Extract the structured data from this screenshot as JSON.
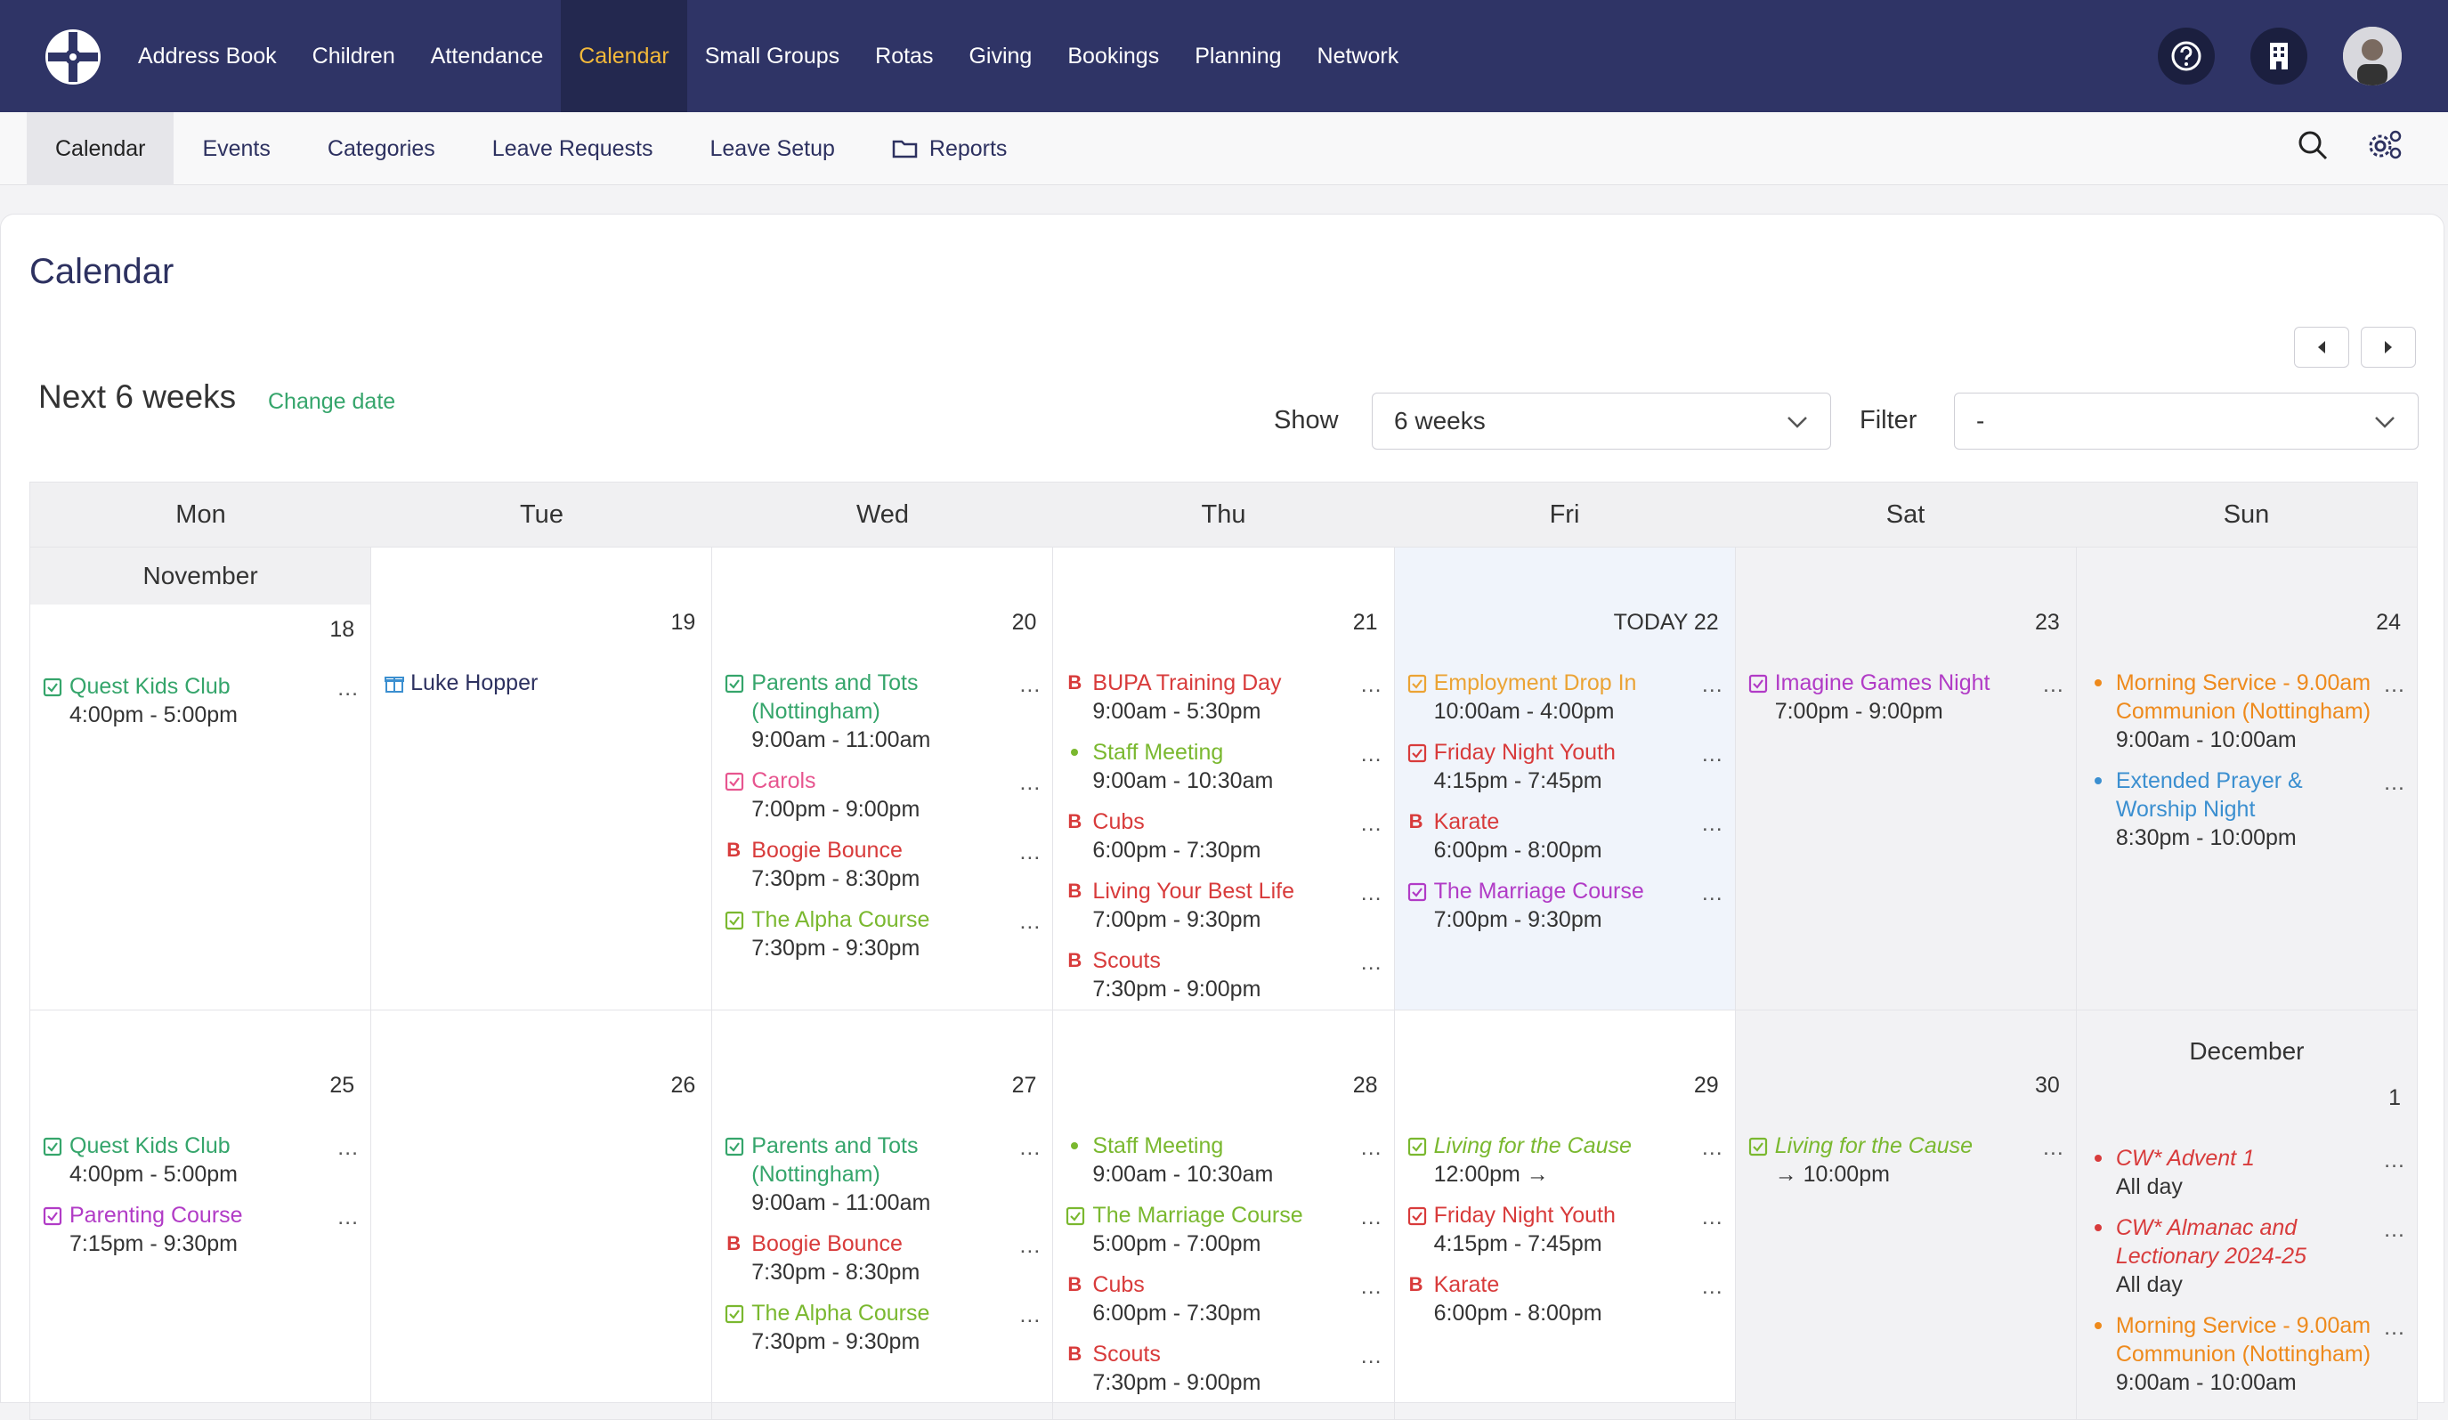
{
  "topnav": {
    "items": [
      "Address Book",
      "Children",
      "Attendance",
      "Calendar",
      "Small Groups",
      "Rotas",
      "Giving",
      "Bookings",
      "Planning",
      "Network"
    ],
    "active": "Calendar"
  },
  "subnav": {
    "items": [
      "Calendar",
      "Events",
      "Categories",
      "Leave Requests",
      "Leave Setup",
      "Reports"
    ],
    "active": "Calendar"
  },
  "page": {
    "title": "Calendar",
    "range_label": "Next 6 weeks",
    "change_date": "Change date",
    "show_label": "Show",
    "show_value": "6 weeks",
    "filter_label": "Filter",
    "filter_value": "-"
  },
  "calendar": {
    "weekdays": [
      "Mon",
      "Tue",
      "Wed",
      "Thu",
      "Fri",
      "Sat",
      "Sun"
    ],
    "months": [
      "November",
      "December"
    ],
    "today_label": "TODAY",
    "colors": {
      "green": "#35a56b",
      "lime": "#7ab82f",
      "pink": "#e7558f",
      "red": "#d83b3b",
      "orange": "#ee8a1c",
      "amber": "#eba334",
      "purple": "#b13bc6",
      "blue": "#3b8fd0",
      "navy": "#2d3160"
    },
    "weeks": [
      {
        "days": [
          {
            "num": "18",
            "events": [
              {
                "title": "Quest Kids Club",
                "time": "4:00pm - 5:00pm",
                "color": "green",
                "marker": "check"
              }
            ]
          },
          {
            "num": "19",
            "events": [
              {
                "title": "Luke Hopper",
                "time": "",
                "color": "navy",
                "marker": "gift"
              }
            ]
          },
          {
            "num": "20",
            "events": [
              {
                "title": "Parents and Tots (Nottingham)",
                "time": "9:00am - 11:00am",
                "color": "green",
                "marker": "check"
              },
              {
                "title": "Carols",
                "time": "7:00pm - 9:00pm",
                "color": "pink",
                "marker": "check"
              },
              {
                "title": "Boogie Bounce",
                "time": "7:30pm - 8:30pm",
                "color": "red",
                "marker": "B"
              },
              {
                "title": "The Alpha Course",
                "time": "7:30pm - 9:30pm",
                "color": "lime",
                "marker": "check"
              }
            ]
          },
          {
            "num": "21",
            "events": [
              {
                "title": "BUPA Training Day",
                "time": "9:00am - 5:30pm",
                "color": "red",
                "marker": "B"
              },
              {
                "title": "Staff Meeting",
                "time": "9:00am - 10:30am",
                "color": "lime",
                "marker": "dot"
              },
              {
                "title": "Cubs",
                "time": "6:00pm - 7:30pm",
                "color": "red",
                "marker": "B"
              },
              {
                "title": "Living Your Best Life",
                "time": "7:00pm - 9:30pm",
                "color": "red",
                "marker": "B"
              },
              {
                "title": "Scouts",
                "time": "7:30pm - 9:00pm",
                "color": "red",
                "marker": "B"
              }
            ]
          },
          {
            "num": "22",
            "today": true,
            "events": [
              {
                "title": "Employment Drop In",
                "time": "10:00am - 4:00pm",
                "color": "amber",
                "marker": "check"
              },
              {
                "title": "Friday Night Youth",
                "time": "4:15pm - 7:45pm",
                "color": "red",
                "marker": "check"
              },
              {
                "title": "Karate",
                "time": "6:00pm - 8:00pm",
                "color": "red",
                "marker": "B"
              },
              {
                "title": "The Marriage Course",
                "time": "7:00pm - 9:30pm",
                "color": "purple",
                "marker": "check"
              }
            ]
          },
          {
            "num": "23",
            "events": [
              {
                "title": "Imagine Games Night",
                "time": "7:00pm - 9:00pm",
                "color": "purple",
                "marker": "check"
              }
            ]
          },
          {
            "num": "24",
            "events": [
              {
                "title": "Morning Service - 9.00am Communion (Nottingham)",
                "time": "9:00am - 10:00am",
                "color": "orange",
                "marker": "dot"
              },
              {
                "title": "Extended Prayer & Worship Night",
                "time": "8:30pm - 10:00pm",
                "color": "blue",
                "marker": "dot"
              }
            ]
          }
        ]
      },
      {
        "days": [
          {
            "num": "25",
            "events": [
              {
                "title": "Quest Kids Club",
                "time": "4:00pm - 5:00pm",
                "color": "green",
                "marker": "check"
              },
              {
                "title": "Parenting Course",
                "time": "7:15pm - 9:30pm",
                "color": "purple",
                "marker": "check"
              }
            ]
          },
          {
            "num": "26",
            "events": []
          },
          {
            "num": "27",
            "events": [
              {
                "title": "Parents and Tots (Nottingham)",
                "time": "9:00am - 11:00am",
                "color": "green",
                "marker": "check"
              },
              {
                "title": "Boogie Bounce",
                "time": "7:30pm - 8:30pm",
                "color": "red",
                "marker": "B"
              },
              {
                "title": "The Alpha Course",
                "time": "7:30pm - 9:30pm",
                "color": "lime",
                "marker": "check"
              }
            ]
          },
          {
            "num": "28",
            "events": [
              {
                "title": "Staff Meeting",
                "time": "9:00am - 10:30am",
                "color": "lime",
                "marker": "dot"
              },
              {
                "title": "The Marriage Course",
                "time": "5:00pm - 7:00pm",
                "color": "lime",
                "marker": "check"
              },
              {
                "title": "Cubs",
                "time": "6:00pm - 7:30pm",
                "color": "red",
                "marker": "B"
              },
              {
                "title": "Scouts",
                "time": "7:30pm - 9:00pm",
                "color": "red",
                "marker": "B"
              }
            ]
          },
          {
            "num": "29",
            "events": [
              {
                "title": "Living for the Cause",
                "time": "12:00pm →",
                "color": "lime",
                "marker": "check",
                "italic": true
              },
              {
                "title": "Friday Night Youth",
                "time": "4:15pm - 7:45pm",
                "color": "red",
                "marker": "check"
              },
              {
                "title": "Karate",
                "time": "6:00pm - 8:00pm",
                "color": "red",
                "marker": "B"
              }
            ]
          },
          {
            "num": "30",
            "events": [
              {
                "title": "Living for the Cause",
                "time": "→ 10:00pm",
                "color": "lime",
                "marker": "check",
                "italic": true
              }
            ]
          },
          {
            "num": "1",
            "month": "December",
            "events": [
              {
                "title": "CW* Advent 1",
                "time": "All day",
                "color": "red",
                "marker": "dot",
                "italic": true
              },
              {
                "title": "CW* Almanac and Lectionary 2024-25",
                "time": "All day",
                "color": "red",
                "marker": "dot",
                "italic": true
              },
              {
                "title": "Morning Service - 9.00am Communion (Nottingham)",
                "time": "9:00am - 10:00am",
                "color": "orange",
                "marker": "dot"
              }
            ]
          }
        ]
      }
    ]
  }
}
